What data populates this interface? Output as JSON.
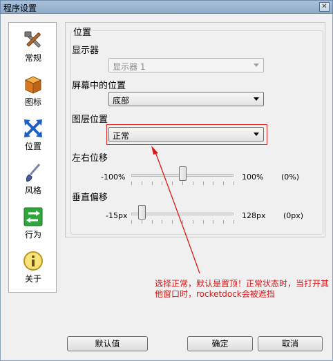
{
  "window": {
    "title": "程序设置"
  },
  "sidebar": {
    "items": [
      {
        "label": "常规",
        "icon": "tools-icon"
      },
      {
        "label": "图标",
        "icon": "box-icon"
      },
      {
        "label": "位置",
        "icon": "arrows-icon"
      },
      {
        "label": "风格",
        "icon": "brush-icon"
      },
      {
        "label": "行为",
        "icon": "behavior-icon"
      },
      {
        "label": "关于",
        "icon": "info-icon"
      }
    ]
  },
  "position": {
    "group_title": "位置",
    "monitor_label": "显示器",
    "monitor_value": "显示器 1",
    "screen_pos_label": "屏幕中的位置",
    "screen_pos_value": "底部",
    "layer_label": "图层位置",
    "layer_value": "正常",
    "h_offset_label": "左右位移",
    "h_min": "-100%",
    "h_max": "100%",
    "h_current": "(0%)",
    "h_value_fraction": 0.5,
    "v_offset_label": "垂直偏移",
    "v_min": "-15px",
    "v_max": "128px",
    "v_current": "(0px)",
    "v_value_fraction": 0.105
  },
  "buttons": {
    "default": "默认值",
    "ok": "确定",
    "cancel": "取消"
  },
  "annotation": {
    "text": "选择正常，默认是置顶！正常状态时，当打开其他窗口时，rocketdock会被遮挡"
  },
  "colors": {
    "annotation": "#e01515"
  }
}
